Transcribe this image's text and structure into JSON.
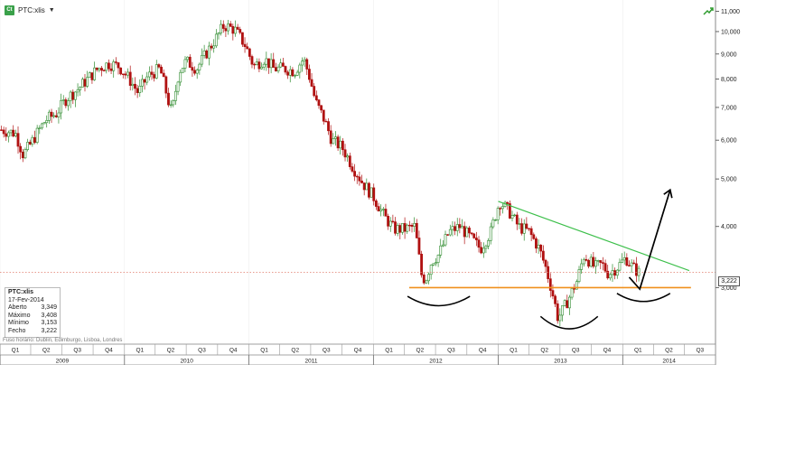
{
  "header": {
    "ticker": "PTC:xlis",
    "logo_text": "Ct",
    "caret": "▼"
  },
  "icons": {
    "logo": "chart-logo-icon",
    "trend": "trend-arrow-icon"
  },
  "colors": {
    "up_candle": "#2e8b2e",
    "down_candle": "#b01010",
    "support_line": "#f0901c",
    "resistance_line": "#3cbf4a",
    "current_price_line": "#e07a6a",
    "annotation": "#000000"
  },
  "info_box": {
    "title": "PTC:xlis",
    "date": "17-Fev-2014",
    "rows": [
      {
        "label": "Aberto",
        "value": "3,349"
      },
      {
        "label": "Máximo",
        "value": "3,408"
      },
      {
        "label": "Mínimo",
        "value": "3,153"
      },
      {
        "label": "Fecho",
        "value": "3,222"
      }
    ]
  },
  "timezone_text": "Fuso horário: Dublin, Edimburgo, Lisboa, Londres",
  "price_badge": "3,222",
  "chart_data": {
    "type": "candlestick",
    "title": "PTC:xlis",
    "y_scale": "log",
    "ylim": [
      2.3,
      11.6
    ],
    "y_ticks": [
      "3,000",
      "4,000",
      "5,000",
      "6,000",
      "7,000",
      "8,000",
      "9,000",
      "10,000",
      "11,000"
    ],
    "y_tick_values": [
      3,
      4,
      5,
      6,
      7,
      8,
      9,
      10,
      11
    ],
    "quarter_labels": [
      "Q1",
      "Q2",
      "Q3",
      "Q4",
      "Q1",
      "Q2",
      "Q3",
      "Q4",
      "Q1",
      "Q2",
      "Q3",
      "Q4",
      "Q1",
      "Q2",
      "Q3",
      "Q4",
      "Q1",
      "Q2",
      "Q3",
      "Q4",
      "Q1",
      "Q2",
      "Q3"
    ],
    "year_labels": [
      "2009",
      "2010",
      "2011",
      "2012",
      "2013",
      "2014"
    ],
    "x_range": [
      "2009-01-01",
      "2014-09-30"
    ],
    "close_path": [
      [
        "2009-01-05",
        6.3
      ],
      [
        "2009-02-15",
        6.2
      ],
      [
        "2009-03-10",
        5.6
      ],
      [
        "2009-04-01",
        5.9
      ],
      [
        "2009-05-15",
        6.6
      ],
      [
        "2009-06-15",
        6.8
      ],
      [
        "2009-07-15",
        7.3
      ],
      [
        "2009-08-15",
        7.6
      ],
      [
        "2009-09-15",
        8.0
      ],
      [
        "2009-10-15",
        8.4
      ],
      [
        "2009-11-15",
        8.6
      ],
      [
        "2009-12-15",
        8.5
      ],
      [
        "2010-01-15",
        8.0
      ],
      [
        "2010-02-10",
        7.5
      ],
      [
        "2010-03-10",
        8.1
      ],
      [
        "2010-04-15",
        8.4
      ],
      [
        "2010-05-10",
        7.2
      ],
      [
        "2010-05-20",
        6.8
      ],
      [
        "2010-06-10",
        8.3
      ],
      [
        "2010-07-01",
        8.7
      ],
      [
        "2010-08-01",
        8.4
      ],
      [
        "2010-09-01",
        9.1
      ],
      [
        "2010-10-01",
        9.8
      ],
      [
        "2010-10-20",
        10.3
      ],
      [
        "2010-11-20",
        10.1
      ],
      [
        "2010-12-20",
        9.4
      ],
      [
        "2011-01-15",
        8.5
      ],
      [
        "2011-02-15",
        8.8
      ],
      [
        "2011-03-15",
        8.4
      ],
      [
        "2011-04-15",
        8.4
      ],
      [
        "2011-05-15",
        8.3
      ],
      [
        "2011-06-10",
        8.8
      ],
      [
        "2011-06-25",
        8.2
      ],
      [
        "2011-07-15",
        7.2
      ],
      [
        "2011-08-10",
        6.6
      ],
      [
        "2011-09-01",
        6.0
      ],
      [
        "2011-10-01",
        5.8
      ],
      [
        "2011-11-01",
        5.3
      ],
      [
        "2011-12-01",
        4.9
      ],
      [
        "2012-01-01",
        4.6
      ],
      [
        "2012-02-01",
        4.2
      ],
      [
        "2012-03-01",
        3.95
      ],
      [
        "2012-04-01",
        3.95
      ],
      [
        "2012-05-01",
        4.0
      ],
      [
        "2012-05-20",
        3.2
      ],
      [
        "2012-06-01",
        3.1
      ],
      [
        "2012-06-20",
        3.4
      ],
      [
        "2012-07-10",
        3.5
      ],
      [
        "2012-08-10",
        3.9
      ],
      [
        "2012-09-10",
        4.0
      ],
      [
        "2012-10-10",
        3.8
      ],
      [
        "2012-11-10",
        3.6
      ],
      [
        "2012-12-10",
        3.9
      ],
      [
        "2013-01-05",
        4.5
      ],
      [
        "2013-02-01",
        4.3
      ],
      [
        "2013-03-01",
        4.0
      ],
      [
        "2013-04-01",
        3.9
      ],
      [
        "2013-05-01",
        3.6
      ],
      [
        "2013-05-20",
        3.3
      ],
      [
        "2013-06-10",
        2.9
      ],
      [
        "2013-06-25",
        2.6
      ],
      [
        "2013-07-10",
        2.7
      ],
      [
        "2013-08-01",
        2.9
      ],
      [
        "2013-08-20",
        3.1
      ],
      [
        "2013-09-10",
        3.5
      ],
      [
        "2013-09-25",
        3.4
      ],
      [
        "2013-10-10",
        3.3
      ],
      [
        "2013-11-01",
        3.35
      ],
      [
        "2013-11-20",
        3.2
      ],
      [
        "2013-12-15",
        3.3
      ],
      [
        "2014-01-10",
        3.45
      ],
      [
        "2014-01-30",
        3.3
      ],
      [
        "2014-02-17",
        3.222
      ]
    ],
    "annotations": {
      "support_level": 3.0,
      "resistance_line": [
        [
          "2013-01-01",
          4.5
        ],
        [
          "2014-07-15",
          3.25
        ]
      ],
      "current_price_line": 3.222,
      "current_price_label": "3,222"
    }
  }
}
